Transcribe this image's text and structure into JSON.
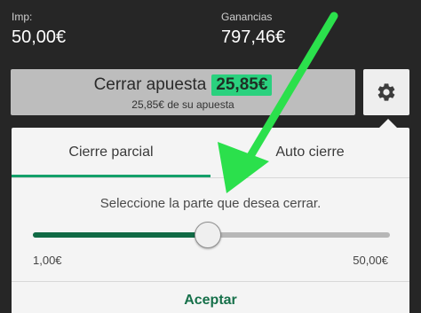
{
  "stats": {
    "stake": {
      "label": "Imp:",
      "value": "50,00€"
    },
    "winnings": {
      "label": "Ganancias",
      "value": "797,46€"
    }
  },
  "cashout": {
    "label": "Cerrar apuesta",
    "amount": "25,85€",
    "subtext": "25,85€ de su apuesta",
    "amount_color": "#2ad17e"
  },
  "settings": {
    "icon": "gear-icon"
  },
  "tabs": [
    {
      "label": "Cierre parcial",
      "active": true
    },
    {
      "label": "Auto cierre",
      "active": false
    }
  ],
  "instruction": "Seleccione la parte que desea cerrar.",
  "slider": {
    "min_label": "1,00€",
    "max_label": "50,00€",
    "fraction": 0.49,
    "fill_color": "#106a45"
  },
  "accept_label": "Aceptar",
  "annotation": {
    "arrow_color": "#2be04c"
  },
  "colors": {
    "accent": "#14a06a",
    "background": "#262626"
  }
}
